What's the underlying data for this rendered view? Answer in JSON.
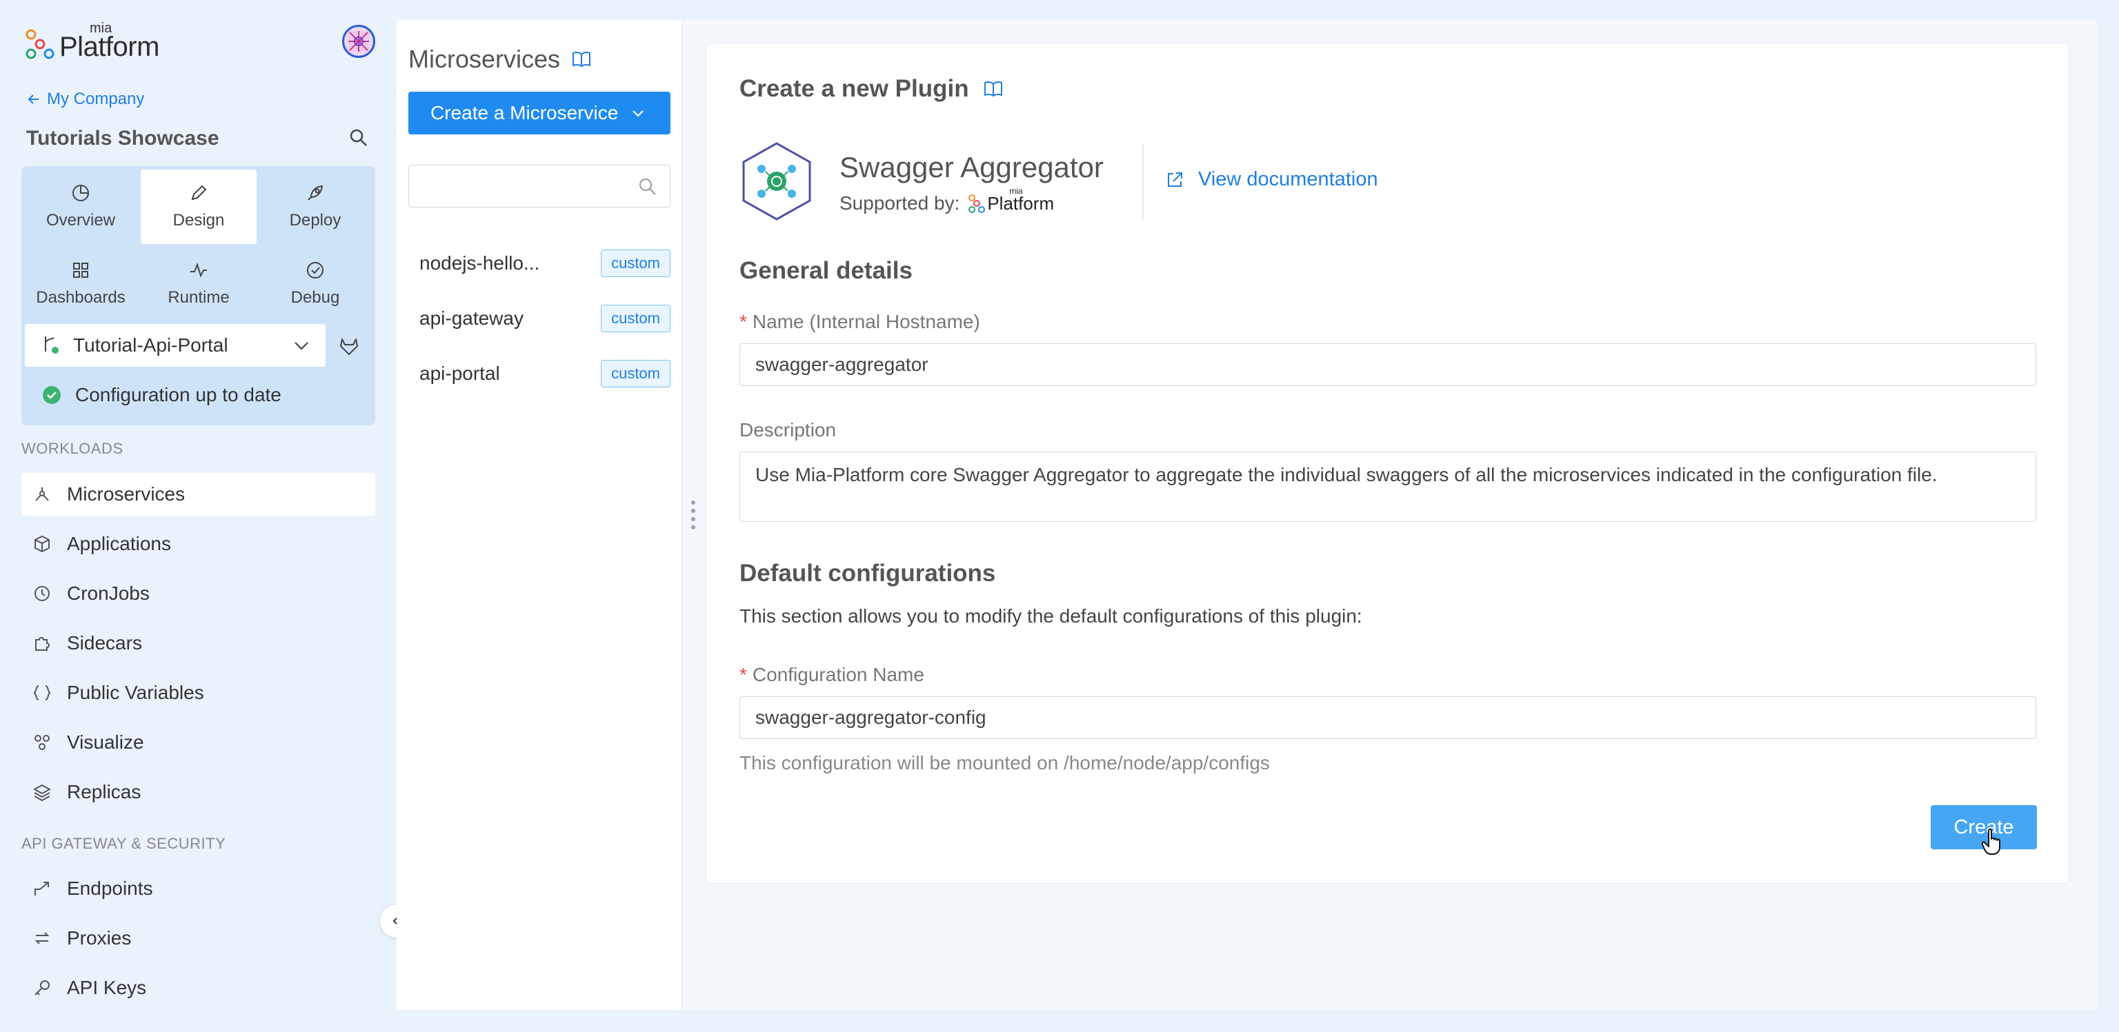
{
  "app": {
    "logo_small": "mia",
    "logo_main": "Platform"
  },
  "sidebar": {
    "back_label": "My Company",
    "project_title": "Tutorials Showcase",
    "modes": [
      {
        "label": "Overview",
        "icon": "pie-chart-icon"
      },
      {
        "label": "Design",
        "icon": "pencil-icon",
        "active": true
      },
      {
        "label": "Deploy",
        "icon": "rocket-icon"
      },
      {
        "label": "Dashboards",
        "icon": "grid-icon"
      },
      {
        "label": "Runtime",
        "icon": "pulse-icon"
      },
      {
        "label": "Debug",
        "icon": "check-circle-icon"
      }
    ],
    "environment": "Tutorial-Api-Portal",
    "config_status": "Configuration up to date",
    "workloads_label": "WORKLOADS",
    "workloads": [
      {
        "label": "Microservices",
        "icon": "microservice-icon",
        "active": true
      },
      {
        "label": "Applications",
        "icon": "cube-icon"
      },
      {
        "label": "CronJobs",
        "icon": "clock-icon"
      },
      {
        "label": "Sidecars",
        "icon": "puzzle-icon"
      },
      {
        "label": "Public Variables",
        "icon": "braces-icon"
      },
      {
        "label": "Visualize",
        "icon": "network-icon"
      },
      {
        "label": "Replicas",
        "icon": "layers-icon"
      }
    ],
    "api_label": "API GATEWAY & SECURITY",
    "api_items": [
      {
        "label": "Endpoints",
        "icon": "endpoint-icon"
      },
      {
        "label": "Proxies",
        "icon": "swap-icon"
      },
      {
        "label": "API Keys",
        "icon": "key-icon"
      }
    ]
  },
  "microservices": {
    "title": "Microservices",
    "create_label": "Create a Microservice",
    "search_placeholder": "",
    "items": [
      {
        "name": "nodejs-hello...",
        "tag": "custom"
      },
      {
        "name": "api-gateway",
        "tag": "custom"
      },
      {
        "name": "api-portal",
        "tag": "custom"
      }
    ]
  },
  "form": {
    "title": "Create a new Plugin",
    "plugin_name": "Swagger Aggregator",
    "supported_by": "Supported by:",
    "supported_logo_small": "mia",
    "supported_logo_main": "Platform",
    "view_doc": "View documentation",
    "general_title": "General details",
    "name_label": "Name (Internal Hostname)",
    "name_value": "swagger-aggregator",
    "description_label": "Description",
    "description_value": "Use Mia-Platform core Swagger Aggregator to aggregate the individual swaggers of all the microservices indicated in the configuration file.",
    "defaults_title": "Default configurations",
    "defaults_desc": "This section allows you to modify the default configurations of this plugin:",
    "config_name_label": "Configuration Name",
    "config_name_value": "swagger-aggregator-config",
    "config_hint": "This configuration will be mounted on /home/node/app/configs",
    "create_label": "Create",
    "required_mark": "*"
  },
  "colors": {
    "accent": "#1f8bf0",
    "link": "#1f7fe0",
    "sidebar_bg": "#eaf2fc",
    "mode_card_bg": "#cfe3f8",
    "success": "#3cb371",
    "required": "#e5484d"
  }
}
